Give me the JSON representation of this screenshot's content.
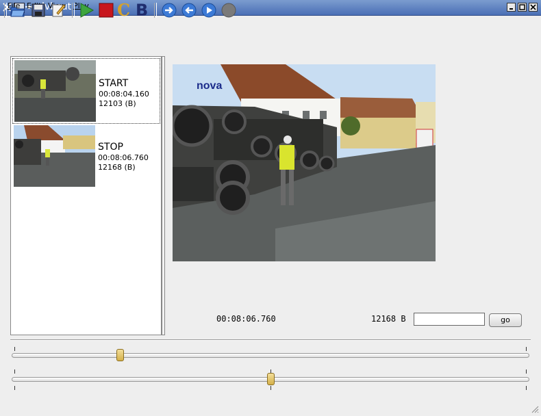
{
  "window": {
    "title": "dvbcut"
  },
  "menu": [
    "File",
    "Edit",
    "View",
    "Play"
  ],
  "toolbar": {
    "icons": [
      "open-folder-icon",
      "save-icon",
      "edit-icon",
      "play-icon",
      "stop-icon",
      "chapter-c-icon",
      "bookmark-b-icon",
      "jump-forward-icon",
      "jump-back-icon",
      "play-forward-icon",
      "record-circle-icon"
    ],
    "chapter_label": "C",
    "bookmark_label": "B"
  },
  "markers": [
    {
      "type": "START",
      "time": "00:08:04.160",
      "frame": "12103 (B)"
    },
    {
      "type": "STOP",
      "time": "00:08:06.760",
      "frame": "12168 (B)"
    }
  ],
  "video": {
    "logo_text": "nova"
  },
  "status": {
    "timecode": "00:08:06.760",
    "frame_readout": "12168 B"
  },
  "go": {
    "input_value": "",
    "button_label": "go"
  },
  "sliders": {
    "coarse_position": 0.205,
    "fine_position": 0.5
  }
}
